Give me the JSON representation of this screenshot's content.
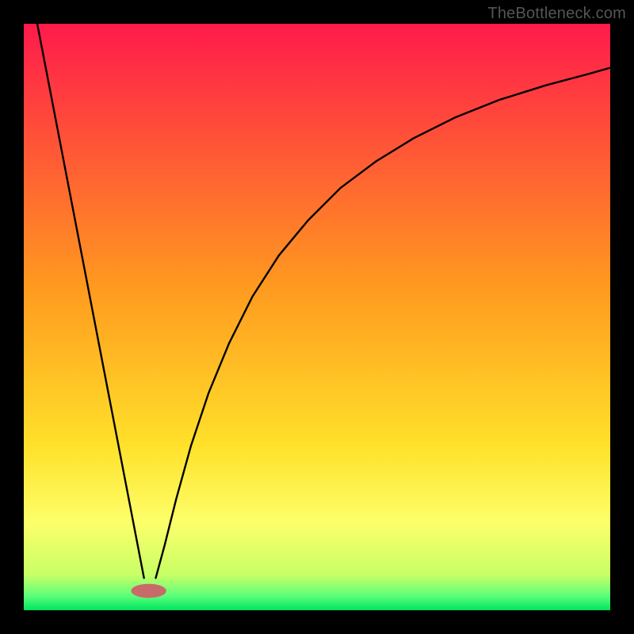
{
  "attribution": "TheBottleneck.com",
  "chart_data": {
    "type": "line",
    "title": "",
    "xlabel": "",
    "ylabel": "",
    "xlim": [
      0,
      1
    ],
    "ylim": [
      0,
      1
    ],
    "gradient_stops": [
      {
        "offset": 0.0,
        "color": "#ff1a4b"
      },
      {
        "offset": 0.45,
        "color": "#ff9a1f"
      },
      {
        "offset": 0.72,
        "color": "#ffe12a"
      },
      {
        "offset": 0.85,
        "color": "#fdff6a"
      },
      {
        "offset": 0.94,
        "color": "#c8ff66"
      },
      {
        "offset": 0.975,
        "color": "#5dff7a"
      },
      {
        "offset": 1.0,
        "color": "#00e560"
      }
    ],
    "series": [
      {
        "name": "left-line",
        "x": [
          0.023,
          0.205
        ],
        "y": [
          1.0,
          0.055
        ]
      },
      {
        "name": "right-curve",
        "x": [
          0.225,
          0.24,
          0.26,
          0.285,
          0.315,
          0.35,
          0.39,
          0.435,
          0.485,
          0.54,
          0.6,
          0.665,
          0.735,
          0.81,
          0.89,
          0.965,
          1.0
        ],
        "y": [
          0.055,
          0.11,
          0.19,
          0.28,
          0.37,
          0.455,
          0.535,
          0.605,
          0.665,
          0.72,
          0.765,
          0.805,
          0.84,
          0.87,
          0.895,
          0.915,
          0.925
        ]
      }
    ],
    "marker": {
      "cx": 0.213,
      "cy": 0.033,
      "rx": 0.03,
      "ry": 0.012,
      "fill": "#c96a6a"
    }
  }
}
